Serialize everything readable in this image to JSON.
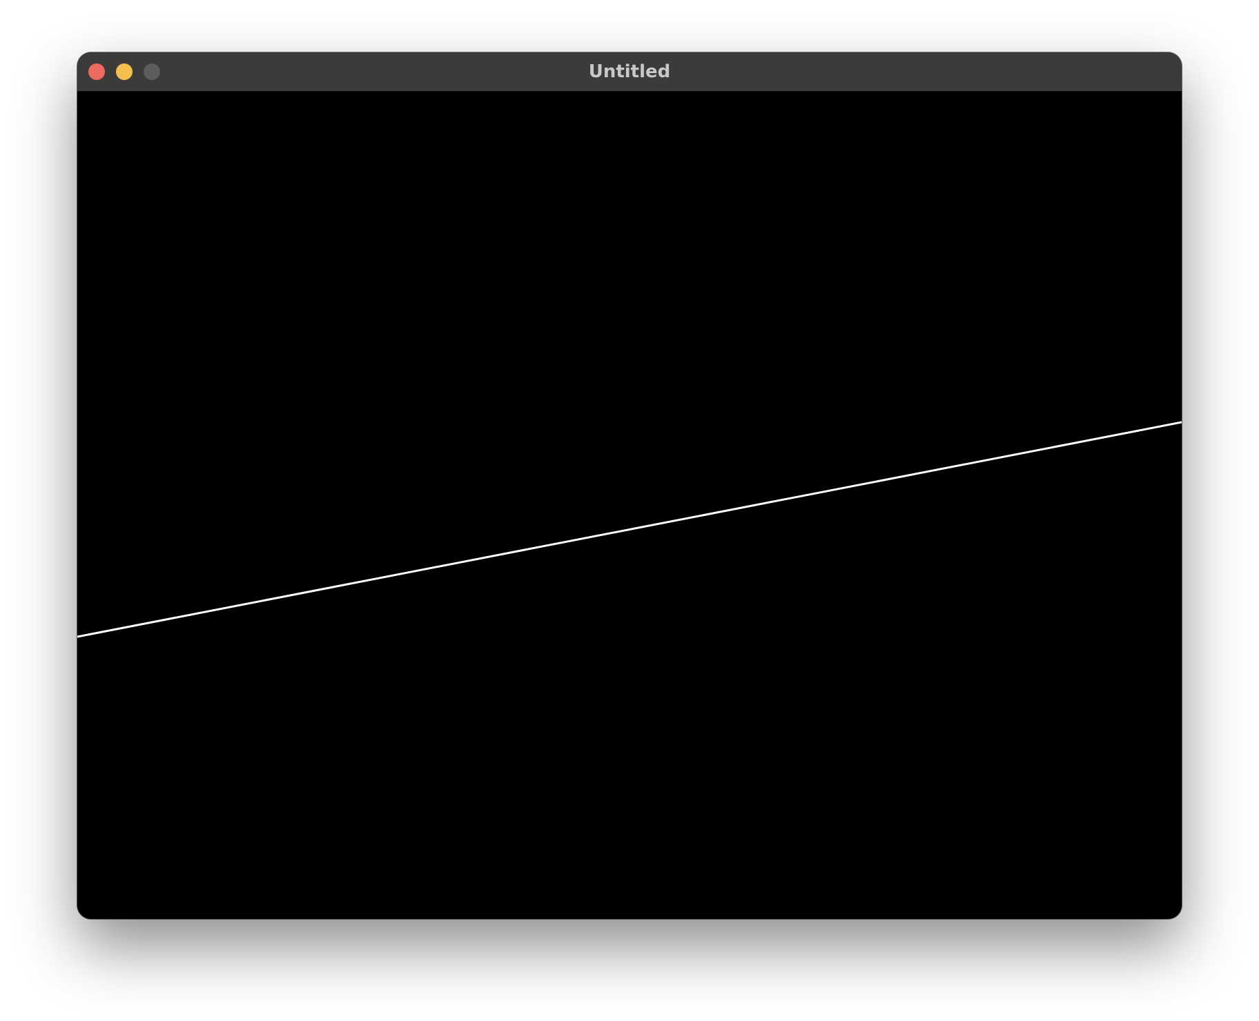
{
  "window": {
    "title": "Untitled",
    "buttons": {
      "close_color": "#ec6a5e",
      "minimize_color": "#f4bf4f",
      "zoom_color": "#5c5c5c"
    }
  },
  "canvas": {
    "background_color": "#000000",
    "line": {
      "color": "#ffffff",
      "description_icon": "line-segment"
    }
  }
}
